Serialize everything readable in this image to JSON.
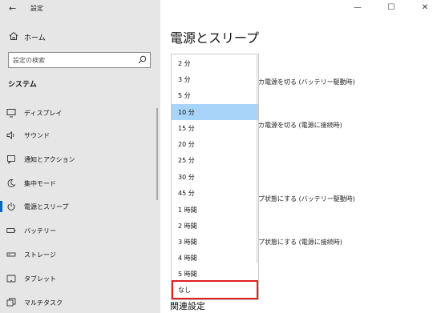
{
  "window": {
    "title": "設定",
    "back_glyph": "←",
    "minimize_glyph": "—",
    "maximize_glyph": "☐",
    "close_glyph": "✕"
  },
  "sidebar": {
    "home_label": "ホーム",
    "search_placeholder": "設定の検索",
    "section_title": "システム",
    "items": [
      {
        "label": "ディスプレイ",
        "icon": "display-icon"
      },
      {
        "label": "サウンド",
        "icon": "speaker-icon"
      },
      {
        "label": "通知とアクション",
        "icon": "notification-icon"
      },
      {
        "label": "集中モード",
        "icon": "moon-icon"
      },
      {
        "label": "電源とスリープ",
        "icon": "power-icon",
        "selected": true
      },
      {
        "label": "バッテリー",
        "icon": "battery-icon"
      },
      {
        "label": "ストレージ",
        "icon": "storage-icon"
      },
      {
        "label": "タブレット",
        "icon": "tablet-icon"
      },
      {
        "label": "マルチタスク",
        "icon": "multitask-icon"
      }
    ]
  },
  "main": {
    "page_title": "電源とスリープ",
    "settings": [
      {
        "label": "カ電源を切る (バッテリー駆動時)"
      },
      {
        "label": "カ電源を切る (電源に接続時)"
      },
      {
        "label": "プ状態にする (バッテリー駆動時)"
      },
      {
        "label": "プ状態にする (電源に接続時)"
      }
    ],
    "related_title": "関連設定"
  },
  "dropdown": {
    "selected_value": "10 分",
    "highlighted_value": "なし",
    "options": [
      "2 分",
      "3 分",
      "5 分",
      "10 分",
      "15 分",
      "20 分",
      "25 分",
      "30 分",
      "45 分",
      "1 時間",
      "2 時間",
      "3 時間",
      "4 時間",
      "5 時間",
      "なし"
    ]
  },
  "colors": {
    "accent": "#0067c0",
    "selection": "#a7d4f8",
    "highlight_border": "#e02020",
    "sidebar_bg": "#e6e6e6"
  }
}
